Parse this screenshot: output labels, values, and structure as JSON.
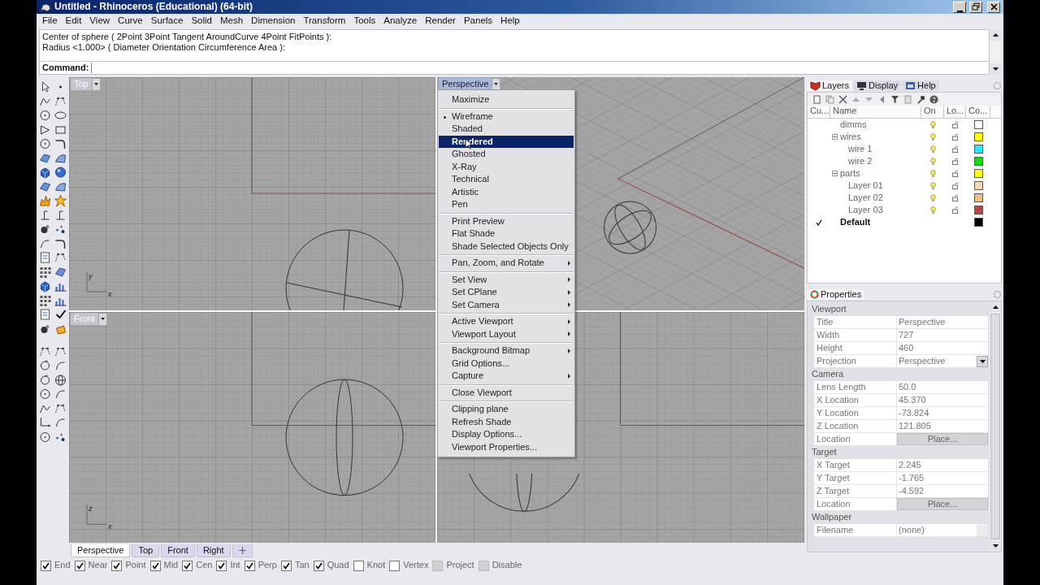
{
  "window": {
    "title": "Untitled - Rhinoceros (Educational) (64-bit)"
  },
  "menu_bar": [
    "File",
    "Edit",
    "View",
    "Curve",
    "Surface",
    "Solid",
    "Mesh",
    "Dimension",
    "Transform",
    "Tools",
    "Analyze",
    "Render",
    "Panels",
    "Help"
  ],
  "command_history": [
    "Center of sphere ( 2Point  3Point  Tangent  AroundCurve  4Point  FitPoints ):",
    "Radius <1.000> ( Diameter  Orientation  Circumference  Area ):"
  ],
  "command_prompt": {
    "label": "Command:"
  },
  "viewports": [
    {
      "kind": "top",
      "label": "Top",
      "axis_labels": [
        "y",
        "x"
      ]
    },
    {
      "kind": "perspective",
      "label": "Perspective"
    },
    {
      "kind": "front",
      "label": "Front",
      "axis_labels": [
        "z",
        "x"
      ]
    },
    {
      "kind": "right"
    }
  ],
  "context_menu": {
    "groups": [
      {
        "items": [
          {
            "label": "Maximize",
            "current": false,
            "selected": false,
            "submenu": false
          }
        ]
      },
      {
        "items": [
          {
            "label": "Wireframe",
            "current": true,
            "selected": false,
            "submenu": false
          },
          {
            "label": "Shaded",
            "current": false,
            "selected": false,
            "submenu": false
          },
          {
            "label": "Rendered",
            "current": false,
            "selected": true,
            "submenu": false
          },
          {
            "label": "Ghosted",
            "current": false,
            "selected": false,
            "submenu": false
          },
          {
            "label": "X-Ray",
            "current": false,
            "selected": false,
            "submenu": false
          },
          {
            "label": "Technical",
            "current": false,
            "selected": false,
            "submenu": false
          },
          {
            "label": "Artistic",
            "current": false,
            "selected": false,
            "submenu": false
          },
          {
            "label": "Pen",
            "current": false,
            "selected": false,
            "submenu": false
          }
        ]
      },
      {
        "items": [
          {
            "label": "Print Preview",
            "current": false,
            "selected": false,
            "submenu": false
          },
          {
            "label": "Flat Shade",
            "current": false,
            "selected": false,
            "submenu": false
          },
          {
            "label": "Shade Selected Objects Only",
            "current": false,
            "selected": false,
            "submenu": false
          }
        ]
      },
      {
        "items": [
          {
            "label": "Pan, Zoom, and Rotate",
            "current": false,
            "selected": false,
            "submenu": true
          }
        ]
      },
      {
        "items": [
          {
            "label": "Set View",
            "current": false,
            "selected": false,
            "submenu": true
          },
          {
            "label": "Set CPlane",
            "current": false,
            "selected": false,
            "submenu": true
          },
          {
            "label": "Set Camera",
            "current": false,
            "selected": false,
            "submenu": true
          }
        ]
      },
      {
        "items": [
          {
            "label": "Active Viewport",
            "current": false,
            "selected": false,
            "submenu": true
          },
          {
            "label": "Viewport Layout",
            "current": false,
            "selected": false,
            "submenu": true
          }
        ]
      },
      {
        "items": [
          {
            "label": "Background Bitmap",
            "current": false,
            "selected": false,
            "submenu": true
          },
          {
            "label": "Grid Options...",
            "current": false,
            "selected": false,
            "submenu": false
          },
          {
            "label": "Capture",
            "current": false,
            "selected": false,
            "submenu": true
          }
        ]
      },
      {
        "items": [
          {
            "label": "Close Viewport",
            "current": false,
            "selected": false,
            "submenu": false
          }
        ]
      },
      {
        "items": [
          {
            "label": "Clipping plane",
            "current": false,
            "selected": false,
            "submenu": false
          },
          {
            "label": "Refresh Shade",
            "current": false,
            "selected": false,
            "submenu": false
          },
          {
            "label": "Display Options...",
            "current": false,
            "selected": false,
            "submenu": false
          },
          {
            "label": "Viewport Properties...",
            "current": false,
            "selected": false,
            "submenu": false
          }
        ]
      }
    ]
  },
  "viewport_tabs": [
    {
      "label": "Perspective",
      "selected": true
    },
    {
      "label": "Top",
      "selected": false
    },
    {
      "label": "Front",
      "selected": false
    },
    {
      "label": "Right",
      "selected": false
    }
  ],
  "osnaps": [
    {
      "kind": "checkbox",
      "label": "End",
      "checked": true
    },
    {
      "kind": "checkbox",
      "label": "Near",
      "checked": true
    },
    {
      "kind": "checkbox",
      "label": "Point",
      "checked": true
    },
    {
      "kind": "checkbox",
      "label": "Mid",
      "checked": true
    },
    {
      "kind": "checkbox",
      "label": "Cen",
      "checked": true
    },
    {
      "kind": "checkbox",
      "label": "Int",
      "checked": true
    },
    {
      "kind": "checkbox",
      "label": "Perp",
      "checked": true
    },
    {
      "kind": "checkbox",
      "label": "Tan",
      "checked": true
    },
    {
      "kind": "checkbox",
      "label": "Quad",
      "checked": true
    },
    {
      "kind": "checkbox",
      "label": "Knot",
      "checked": false
    },
    {
      "kind": "checkbox",
      "label": "Vertex",
      "checked": false
    },
    {
      "kind": "toggle",
      "label": "Project",
      "checked": false
    },
    {
      "kind": "toggle",
      "label": "Disable",
      "checked": false
    }
  ],
  "layers_panel": {
    "tabs": [
      {
        "label": "Layers",
        "selected": true
      },
      {
        "label": "Display",
        "selected": false
      },
      {
        "label": "Help",
        "selected": false
      }
    ],
    "columns": [
      "Cu...",
      "Name",
      "On",
      "Lo...",
      "Co..."
    ],
    "layers": [
      {
        "name": "dimms",
        "current": false,
        "on": true,
        "locked": false,
        "color": "#ffffff"
      },
      {
        "name": "wires",
        "current": false,
        "on": true,
        "locked": false,
        "color": "#ffff00",
        "expanded": true,
        "children": [
          {
            "name": "wire 1",
            "current": false,
            "on": true,
            "locked": false,
            "color": "#22eeff"
          },
          {
            "name": "wire 2",
            "current": false,
            "on": true,
            "locked": false,
            "color": "#11dd11"
          }
        ]
      },
      {
        "name": "parts",
        "current": false,
        "on": true,
        "locked": false,
        "color": "#ffff00",
        "expanded": true,
        "children": [
          {
            "name": "Layer 01",
            "current": false,
            "on": true,
            "locked": false,
            "color": "#f8d6b8"
          },
          {
            "name": "Layer 02",
            "current": false,
            "on": true,
            "locked": false,
            "color": "#f2c07e"
          },
          {
            "name": "Layer 03",
            "current": false,
            "on": true,
            "locked": false,
            "color": "#b04a48"
          }
        ]
      },
      {
        "name": "Default",
        "current": true,
        "color": "#000000"
      }
    ]
  },
  "properties_panel": {
    "tab": "Properties",
    "sections": [
      {
        "title": "Viewport",
        "rows": [
          {
            "kind": "text",
            "label": "Title",
            "value": "Perspective"
          },
          {
            "kind": "text",
            "label": "Width",
            "value": "727"
          },
          {
            "kind": "text",
            "label": "Height",
            "value": "460"
          },
          {
            "kind": "dropdown",
            "label": "Projection",
            "value": "Perspective"
          }
        ]
      },
      {
        "title": "Camera",
        "rows": [
          {
            "kind": "text",
            "label": "Lens Length",
            "value": "50.0"
          },
          {
            "kind": "text",
            "label": "X Location",
            "value": "45.370"
          },
          {
            "kind": "text",
            "label": "Y Location",
            "value": "-73.824"
          },
          {
            "kind": "text",
            "label": "Z Location",
            "value": "121.805"
          },
          {
            "kind": "button",
            "label": "Location",
            "value": "Place..."
          }
        ]
      },
      {
        "title": "Target",
        "rows": [
          {
            "kind": "text",
            "label": "X Target",
            "value": "2.245"
          },
          {
            "kind": "text",
            "label": "Y Target",
            "value": "-1.765"
          },
          {
            "kind": "text",
            "label": "Z Target",
            "value": "-4.592"
          },
          {
            "kind": "button",
            "label": "Location",
            "value": "Place..."
          }
        ]
      },
      {
        "title": "Wallpaper",
        "rows": [
          {
            "kind": "browse",
            "label": "Filename",
            "value": "(none)"
          }
        ]
      }
    ]
  }
}
